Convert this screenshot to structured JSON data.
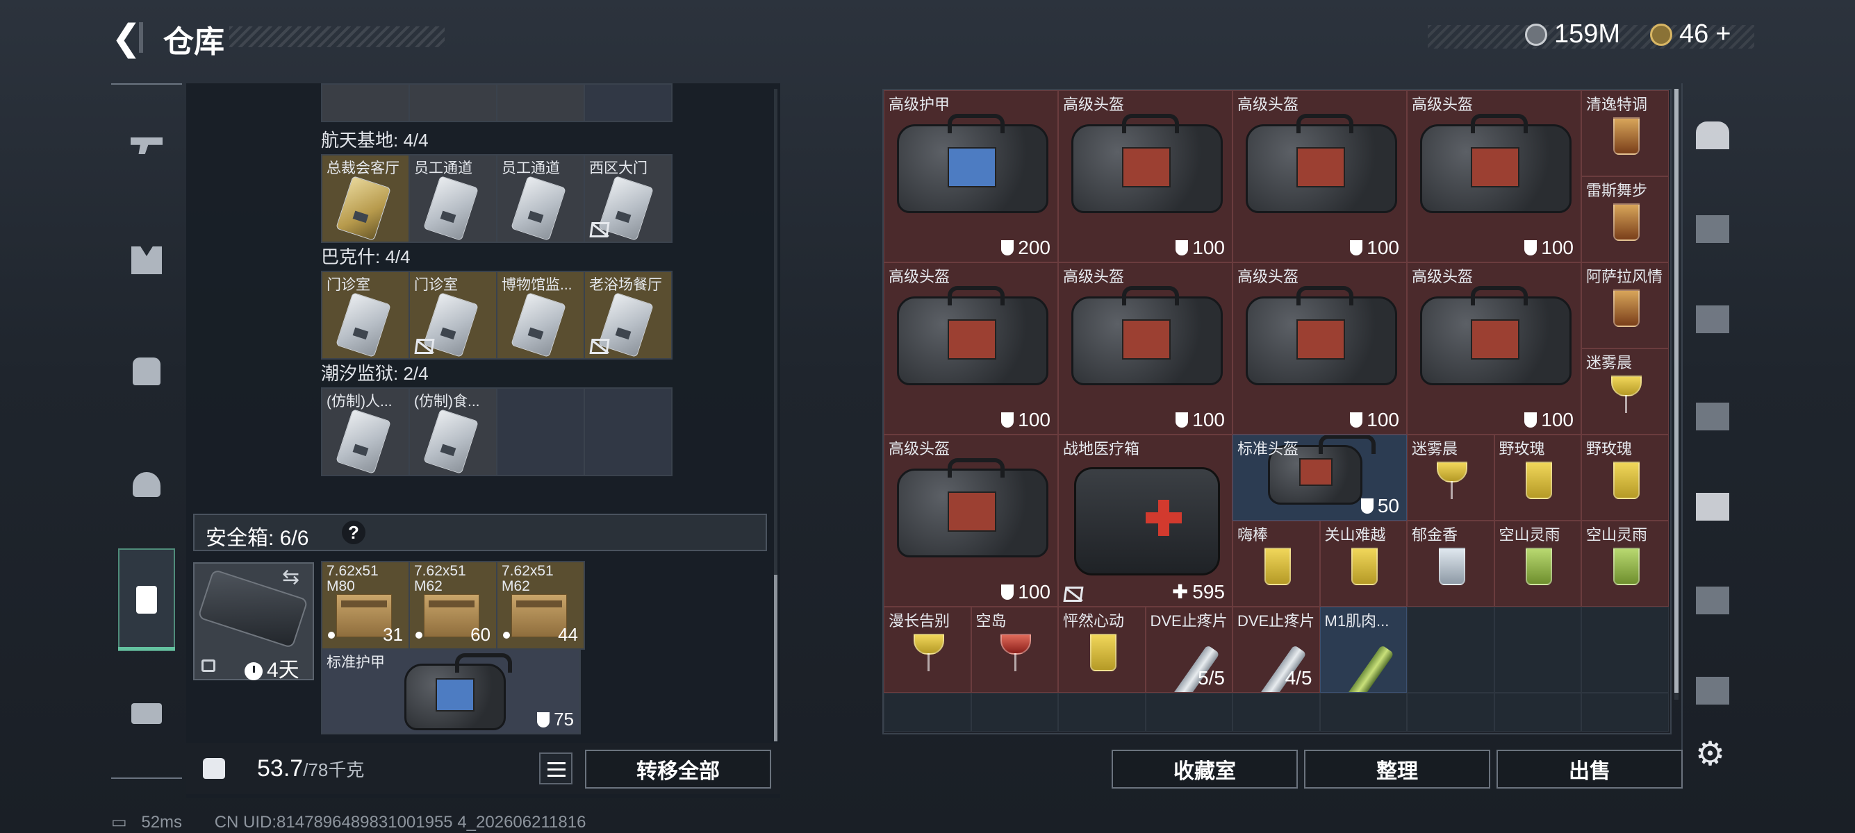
{
  "header": {
    "back_label": "<",
    "title": "仓库",
    "currency1": "159M",
    "currency2": "46",
    "currency2_plus": "+"
  },
  "left": {
    "sections": [
      {
        "title": "航天基地: 4/4",
        "items": [
          {
            "label": "总裁会客厅",
            "style": "gold",
            "restricted": false
          },
          {
            "label": "员工通道",
            "style": "grey",
            "restricted": false
          },
          {
            "label": "员工通道",
            "style": "grey",
            "restricted": false
          },
          {
            "label": "西区大门",
            "style": "grey",
            "restricted": true
          }
        ]
      },
      {
        "title": "巴克什: 4/4",
        "items": [
          {
            "label": "门诊室",
            "style": "gold",
            "restricted": false
          },
          {
            "label": "门诊室",
            "style": "gold",
            "restricted": true
          },
          {
            "label": "博物馆监...",
            "style": "gold",
            "restricted": false
          },
          {
            "label": "老浴场餐厅",
            "style": "gold",
            "restricted": true
          }
        ]
      },
      {
        "title": "潮汐监狱: 2/4",
        "items": [
          {
            "label": "(仿制)人...",
            "style": "grey",
            "restricted": false
          },
          {
            "label": "(仿制)食...",
            "style": "grey",
            "restricted": false
          }
        ]
      }
    ],
    "safe_box": {
      "label": "安全箱: 6/6",
      "help": "?",
      "duration": "4天",
      "ammo": [
        {
          "label": "7.62x51 M80",
          "count": "31"
        },
        {
          "label": "7.62x51 M62",
          "count": "60"
        },
        {
          "label": "7.62x51 M62",
          "count": "44"
        }
      ],
      "armor": {
        "label": "标准护甲",
        "value": "75"
      }
    },
    "weight": {
      "current": "53.7",
      "max": "/78千克"
    },
    "transfer_all": "转移全部"
  },
  "right": {
    "cells": [
      {
        "label": "高级护甲",
        "value": "200",
        "kind": "bag-blue"
      },
      {
        "label": "高级头盔",
        "value": "100",
        "kind": "bag"
      },
      {
        "label": "高级头盔",
        "value": "100",
        "kind": "bag"
      },
      {
        "label": "高级头盔",
        "value": "100",
        "kind": "bag"
      },
      {
        "label": "清逸特调",
        "kind": "glass-amber"
      },
      {
        "label": "雷斯舞步",
        "kind": "glass-amber"
      },
      {
        "label": "高级头盔",
        "value": "100",
        "kind": "bag"
      },
      {
        "label": "高级头盔",
        "value": "100",
        "kind": "bag"
      },
      {
        "label": "高级头盔",
        "value": "100",
        "kind": "bag"
      },
      {
        "label": "高级头盔",
        "value": "100",
        "kind": "bag"
      },
      {
        "label": "阿萨拉风情",
        "kind": "glass-amber"
      },
      {
        "label": "迷雾晨",
        "kind": "cocktail-yellow"
      },
      {
        "label": "高级头盔",
        "value": "100",
        "kind": "bag"
      },
      {
        "label": "战地医疗箱",
        "value": "595",
        "kind": "medkit"
      },
      {
        "label": "标准头盔",
        "value": "50",
        "kind": "bag-small"
      },
      {
        "label": "迷雾晨",
        "kind": "cocktail-yellow"
      },
      {
        "label": "野玫瑰",
        "kind": "glass-yellow"
      },
      {
        "label": "野玫瑰",
        "kind": "glass-yellow"
      },
      {
        "label": "嗨棒",
        "kind": "glass-yellow"
      },
      {
        "label": "关山难越",
        "kind": "glass-yellow"
      },
      {
        "label": "郁金香",
        "kind": "glass-clear"
      },
      {
        "label": "空山灵雨",
        "kind": "glass-green"
      },
      {
        "label": "空山灵雨",
        "kind": "glass-green"
      },
      {
        "label": "漫长告别",
        "kind": "cocktail-yellow"
      },
      {
        "label": "空岛",
        "kind": "cocktail-red"
      },
      {
        "label": "怦然心动",
        "kind": "glass-yellow"
      },
      {
        "label": "DVE止疼片",
        "value": "5/5",
        "kind": "syringe"
      },
      {
        "label": "DVE止疼片",
        "value": "4/5",
        "kind": "syringe"
      },
      {
        "label": "M1肌肉...",
        "kind": "syringe-green"
      }
    ],
    "buttons": {
      "collection": "收藏室",
      "sort": "整理",
      "sell": "出售"
    }
  },
  "status": {
    "ping": "52ms",
    "uid": "CN UID:8147896489831001955 4_202606211816"
  }
}
